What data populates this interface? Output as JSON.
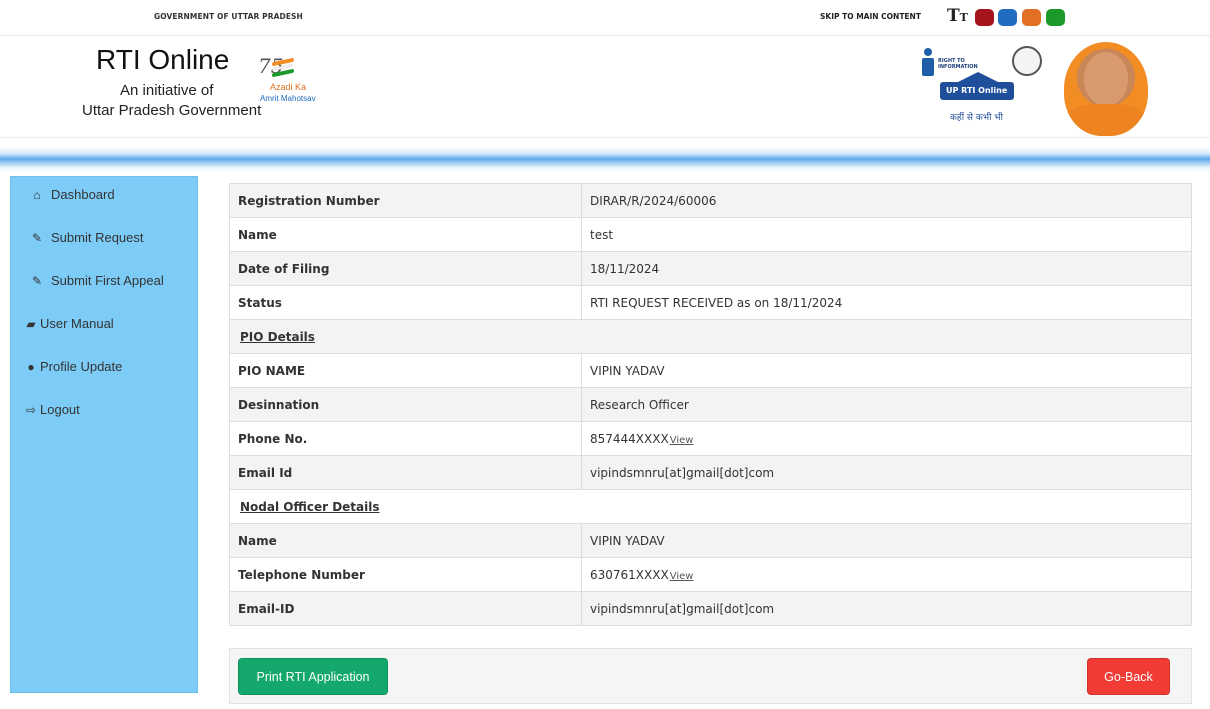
{
  "topbar": {
    "gov_label": "GOVERNMENT OF UTTAR PRADESH",
    "skip_link": "SKIP TO MAIN CONTENT",
    "text_size_icon": "T",
    "text_size_icon_small": "T",
    "theme_colors": [
      "#a5141b",
      "#1f6cc0",
      "#e27024",
      "#1b9a2a"
    ]
  },
  "header": {
    "title": "RTI Online",
    "subtitle_line1": "An initiative of",
    "subtitle_line2": "Uttar Pradesh Government",
    "azadi_logo": {
      "seventy": "75",
      "line1": "Azadi Ka",
      "line2": "Amrit Mahotsav"
    },
    "rti_logo": {
      "right_text": "RIGHT TO INFORMATION",
      "banner": "UP RTI Online",
      "tagline": "कहीं से कभी भी"
    }
  },
  "sidebar": {
    "items": [
      {
        "label": "Dashboard",
        "icon": "home-icon",
        "glyph": "⌂"
      },
      {
        "label": "Submit Request",
        "icon": "pencil-icon",
        "glyph": "✎"
      },
      {
        "label": "Submit First Appeal",
        "icon": "pencil-icon",
        "glyph": "✎"
      },
      {
        "label": "User Manual",
        "icon": "book-icon",
        "glyph": "▰"
      },
      {
        "label": "Profile Update",
        "icon": "user-icon",
        "glyph": "●"
      },
      {
        "label": "Logout",
        "icon": "logout-icon",
        "glyph": "⇨"
      }
    ]
  },
  "details": {
    "registration_number": {
      "label": "Registration Number",
      "value": "DIRAR/R/2024/60006"
    },
    "name": {
      "label": "Name",
      "value": "test"
    },
    "date_of_filing": {
      "label": "Date of Filing",
      "value": "18/11/2024"
    },
    "status": {
      "label": "Status",
      "value": "RTI REQUEST RECEIVED as on 18/11/2024"
    },
    "pio_section": "PIO Details",
    "pio_name": {
      "label": "PIO NAME",
      "value": "VIPIN YADAV"
    },
    "designation": {
      "label": "Desinnation",
      "value": "Research Officer"
    },
    "phone": {
      "label": "Phone No.",
      "value": "857444XXXX",
      "link": "View"
    },
    "email": {
      "label": "Email Id",
      "value": "vipindsmnru[at]gmail[dot]com"
    },
    "nodal_section": "Nodal Officer Details",
    "nodal_name": {
      "label": "Name",
      "value": "VIPIN YADAV"
    },
    "telephone": {
      "label": "Telephone Number",
      "value": "630761XXXX",
      "link": "View"
    },
    "nodal_email": {
      "label": "Email-ID",
      "value": "vipindsmnru[at]gmail[dot]com"
    }
  },
  "actions": {
    "print_label": "Print RTI Application",
    "back_label": "Go-Back",
    "print_color": "#14a86c",
    "back_color": "#f13b34"
  }
}
